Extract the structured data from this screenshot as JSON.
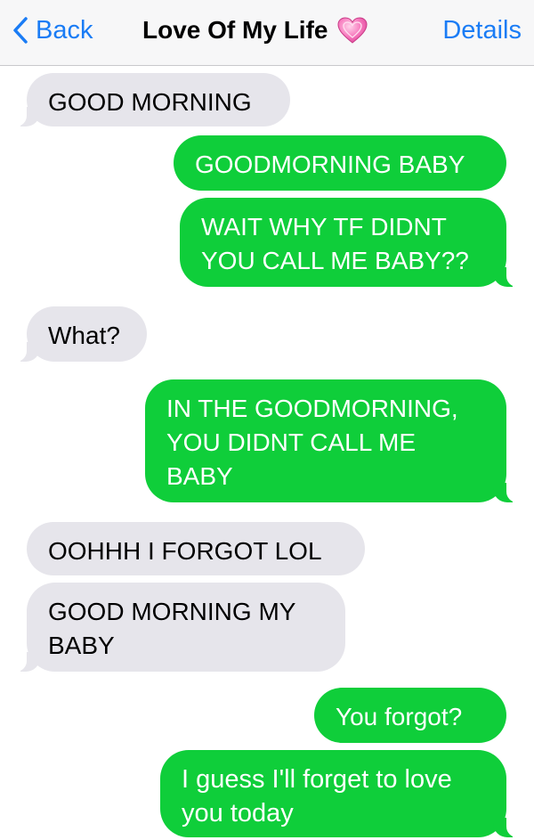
{
  "header": {
    "back_label": "Back",
    "contact_name": "Love Of My Life",
    "details_label": "Details",
    "heart_emoji": "pink-heart-icon"
  },
  "colors": {
    "accent": "#1a7cf5",
    "sent_bubble": "#0fce3a",
    "received_bubble": "#e6e5eb"
  },
  "messages": [
    {
      "direction": "received",
      "text": "GOOD MORNING"
    },
    {
      "direction": "sent",
      "text": "GOODMORNING BABY"
    },
    {
      "direction": "sent",
      "text": "WAIT WHY TF DIDNT YOU CALL ME BABY??"
    },
    {
      "direction": "received",
      "text": "What?"
    },
    {
      "direction": "sent",
      "text": "IN THE GOODMORNING, YOU DIDNT CALL ME BABY"
    },
    {
      "direction": "received",
      "text": "OOHHH I FORGOT LOL"
    },
    {
      "direction": "received",
      "text": "GOOD MORNING MY BABY"
    },
    {
      "direction": "sent",
      "text": "You forgot?"
    },
    {
      "direction": "sent",
      "text": "I guess I'll forget to love you today"
    }
  ]
}
